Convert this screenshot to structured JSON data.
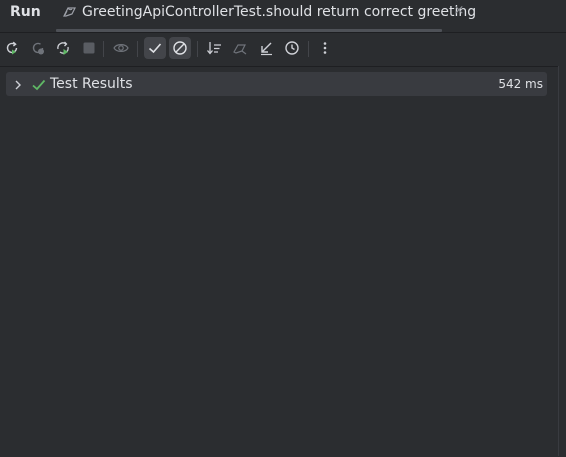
{
  "window": {
    "panel_title": "Run",
    "tab_title": "GreetingApiControllerTest.should return correct greeting",
    "tab_close": "×"
  },
  "toolbar": {
    "buttons": [
      {
        "icon": "rerun-icon",
        "enabled": true
      },
      {
        "icon": "rerun-failed-icon",
        "enabled": false
      },
      {
        "icon": "toggle-auto-test-icon",
        "enabled": true
      },
      {
        "icon": "stop-icon",
        "enabled": false
      },
      {
        "icon": "eye-icon",
        "enabled": false
      },
      {
        "icon": "show-passed-check-icon",
        "active": true
      },
      {
        "icon": "show-ignored-icon",
        "active": true
      },
      {
        "icon": "sort-icon",
        "enabled": true
      },
      {
        "icon": "import-tests-icon",
        "enabled": false
      },
      {
        "icon": "collapse-icon",
        "enabled": true
      },
      {
        "icon": "history-icon",
        "enabled": true
      },
      {
        "icon": "more-icon",
        "enabled": true
      }
    ]
  },
  "tree": {
    "root": {
      "label": "Test Results",
      "time": "542 ms",
      "status": "passed",
      "expanded": false
    }
  },
  "colors": {
    "background": "#2b2d30",
    "selection": "#393b40",
    "success": "#5fb865",
    "text": "#dfe1e5",
    "disabled": "#6f737a"
  }
}
